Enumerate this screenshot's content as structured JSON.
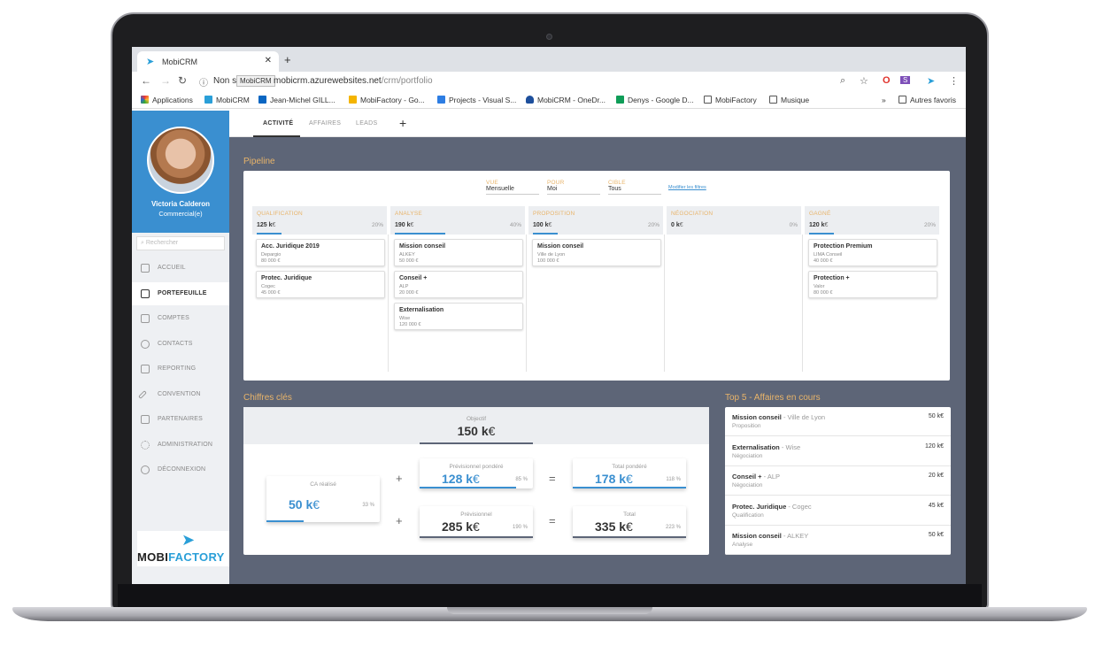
{
  "browser": {
    "tab_title": "MobiCRM",
    "url_prefix": "Non s",
    "tooltip": "MobiCRM",
    "url_host": "mobicrm.azurewebsites.net",
    "url_path": "/crm/portfolio",
    "bookmarks": [
      "Applications",
      "MobiCRM",
      "Jean-Michel GILL...",
      "MobiFactory - Go...",
      "Projects - Visual S...",
      "MobiCRM - OneDr...",
      "Denys - Google D...",
      "MobiFactory",
      "Musique"
    ],
    "other_bookmarks": "Autres favoris"
  },
  "profile": {
    "name": "Victoria Calderon",
    "role": "Commercial(e)"
  },
  "search": {
    "placeholder": "Rechercher"
  },
  "nav": [
    {
      "label": "ACCUEIL"
    },
    {
      "label": "PORTEFEUILLE"
    },
    {
      "label": "COMPTES"
    },
    {
      "label": "CONTACTS"
    },
    {
      "label": "REPORTING"
    },
    {
      "label": "CONVENTION"
    },
    {
      "label": "PARTENAIRES"
    },
    {
      "label": "ADMINISTRATION"
    },
    {
      "label": "DÉCONNEXION"
    }
  ],
  "logo": {
    "part1": "MOBI",
    "part2": "FACTORY"
  },
  "tabs": [
    {
      "label": "ACTIVITÉ"
    },
    {
      "label": "AFFAIRES"
    },
    {
      "label": "LEADS"
    },
    {
      "label": "+"
    }
  ],
  "pipeline": {
    "title": "Pipeline",
    "filters": [
      {
        "label": "VUE",
        "value": "Mensuelle"
      },
      {
        "label": "POUR",
        "value": "Moi"
      },
      {
        "label": "CIBLE",
        "value": "Tous"
      }
    ],
    "modify_link": "Modifier les filtres",
    "columns": [
      {
        "name": "QUALIFICATION",
        "value": "125 k",
        "unit": "€",
        "percent": "20%",
        "fill": 0.2,
        "deals": [
          {
            "name": "Acc. Juridique 2019",
            "client": "Depargio",
            "amount": "80 000 €"
          },
          {
            "name": "Protec. Juridique",
            "client": "Cogec",
            "amount": "45 000 €"
          }
        ]
      },
      {
        "name": "ANALYSE",
        "value": "190 k",
        "unit": "€",
        "percent": "40%",
        "fill": 0.4,
        "deals": [
          {
            "name": "Mission conseil",
            "client": "ALKEY",
            "amount": "50 000 €"
          },
          {
            "name": "Conseil +",
            "client": "ALP",
            "amount": "20 000 €"
          },
          {
            "name": "Externalisation",
            "client": "Wise",
            "amount": "120 000 €"
          }
        ]
      },
      {
        "name": "PROPOSITION",
        "value": "100 k",
        "unit": "€",
        "percent": "20%",
        "fill": 0.2,
        "deals": [
          {
            "name": "Mission conseil",
            "client": "Ville de Lyon",
            "amount": "100 000 €"
          }
        ]
      },
      {
        "name": "NÉGOCIATION",
        "value": "0 k",
        "unit": "€",
        "percent": "0%",
        "fill": 0,
        "deals": []
      },
      {
        "name": "GAGNÉ",
        "value": "120 k",
        "unit": "€",
        "percent": "20%",
        "fill": 0.2,
        "deals": [
          {
            "name": "Protection Premium",
            "client": "LIMA Conseil",
            "amount": "40 000 €"
          },
          {
            "name": "Protection +",
            "client": "Valor",
            "amount": "80 000 €"
          }
        ]
      }
    ]
  },
  "key_figures": {
    "title": "Chiffres clés",
    "objective_label": "Objectif",
    "objective_value": "150 k",
    "euro": "€",
    "realized": {
      "label": "CA réalisé",
      "value": "50 k",
      "percent": "33 %",
      "fill": 0.33,
      "color": "#3a8fd0"
    },
    "weighted": {
      "label": "Prévisionnel pondéré",
      "value": "128 k",
      "percent": "85 %",
      "fill": 0.85,
      "color": "#3a8fd0"
    },
    "total_weighted": {
      "label": "Total pondéré",
      "value": "178 k",
      "percent": "118 %",
      "fill": 1.0,
      "color": "#3a8fd0"
    },
    "forecast": {
      "label": "Prévisionnel",
      "value": "285 k",
      "percent": "190 %",
      "fill": 1.0,
      "color": "#333333"
    },
    "total": {
      "label": "Total",
      "value": "335 k",
      "percent": "223 %",
      "fill": 1.0,
      "color": "#333333"
    },
    "ops": {
      "plus": "+",
      "equals": "="
    }
  },
  "top5": {
    "title": "Top 5 - Affaires en cours",
    "items": [
      {
        "name": "Mission conseil",
        "client": " - Ville de Lyon",
        "stage": "Proposition",
        "amount": "50 k€"
      },
      {
        "name": "Externalisation",
        "client": " - Wise",
        "stage": "Négociation",
        "amount": "120 k€"
      },
      {
        "name": "Conseil +",
        "client": " - ALP",
        "stage": "Négociation",
        "amount": "20 k€"
      },
      {
        "name": "Protec. Juridique",
        "client": " - Cogec",
        "stage": "Qualification",
        "amount": "45 k€"
      },
      {
        "name": "Mission conseil",
        "client": " - ALKEY",
        "stage": "Analyse",
        "amount": "50 k€"
      }
    ]
  },
  "colors": {
    "accent": "#3a8fd0",
    "label_orange": "#e8b46a",
    "main_bg": "#5d6577"
  }
}
